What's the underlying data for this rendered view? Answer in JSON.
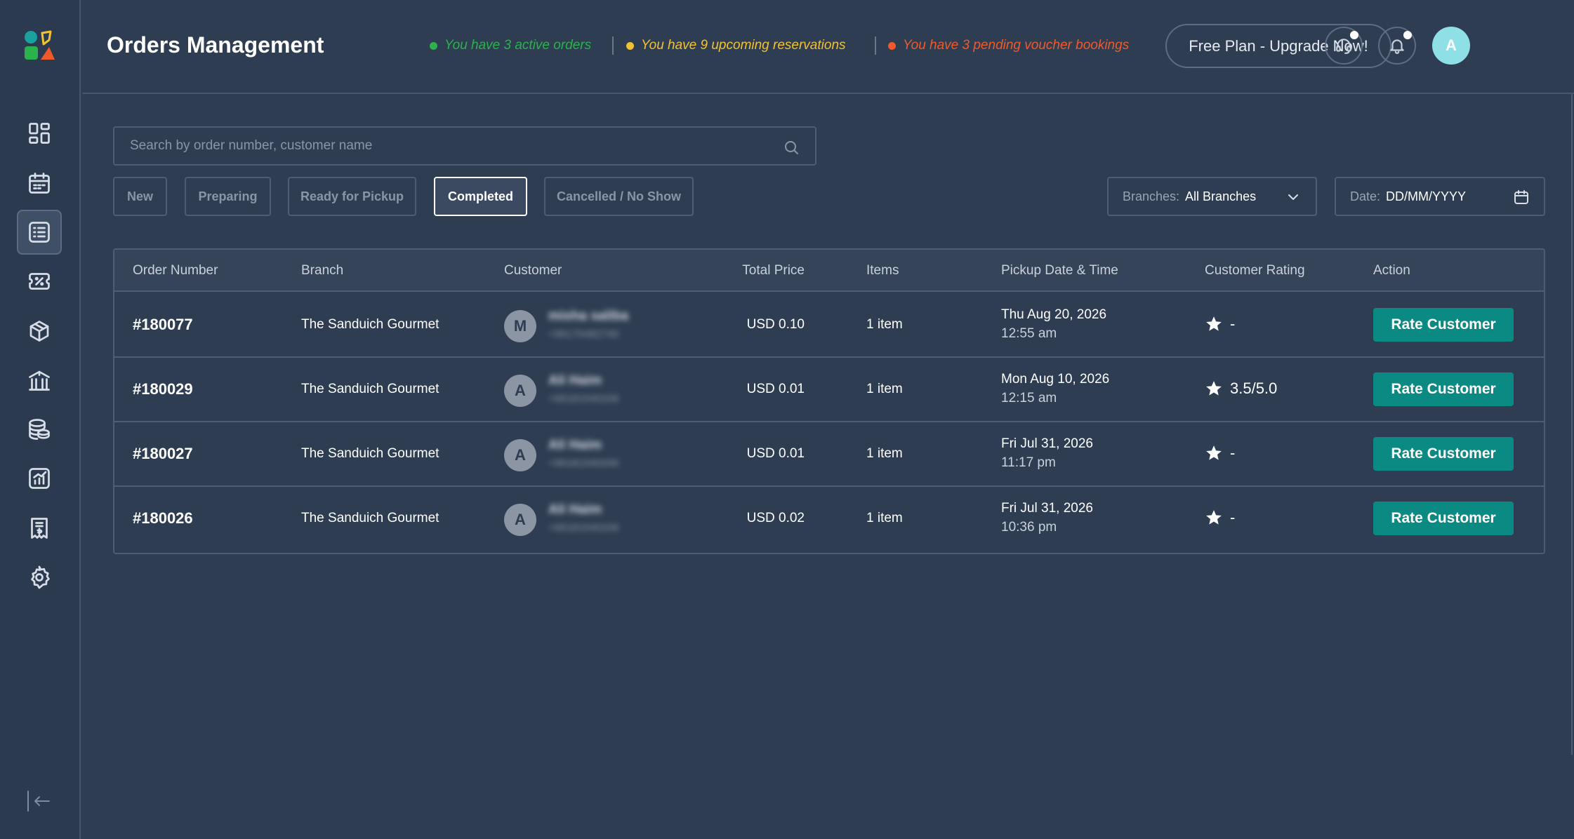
{
  "header": {
    "title": "Orders Management",
    "statuses": [
      {
        "text": "You have 3 active orders",
        "color": "#2bb24c"
      },
      {
        "text": "You have 9 upcoming reservations",
        "color": "#f2c230"
      },
      {
        "text": "You have 3 pending voucher bookings",
        "color": "#f05a2a"
      }
    ],
    "upgrade_label": "Free Plan - Upgrade Now!",
    "avatar_initial": "A"
  },
  "sidebar": {
    "items": [
      {
        "name": "dashboard-icon"
      },
      {
        "name": "calendar-icon"
      },
      {
        "name": "orders-list-icon",
        "active": true
      },
      {
        "name": "voucher-icon"
      },
      {
        "name": "box-icon"
      },
      {
        "name": "branch-icon"
      },
      {
        "name": "coins-icon"
      },
      {
        "name": "analytics-icon"
      },
      {
        "name": "receipt-icon"
      },
      {
        "name": "gear-icon"
      }
    ],
    "logout": "logout-icon"
  },
  "search": {
    "placeholder": "Search by order number, customer name"
  },
  "filters": {
    "tabs": [
      {
        "label": "New"
      },
      {
        "label": "Preparing"
      },
      {
        "label": "Ready for Pickup"
      },
      {
        "label": "Completed",
        "active": true
      },
      {
        "label": "Cancelled / No Show"
      }
    ],
    "branches_label": "Branches:",
    "branches_value": "All Branches",
    "date_label": "Date:",
    "date_value": "DD/MM/YYYY"
  },
  "table": {
    "columns": [
      "Order Number",
      "Branch",
      "Customer",
      "Total Price",
      "Items",
      "Pickup Date & Time",
      "Customer Rating",
      "Action"
    ],
    "rows": [
      {
        "order": "#180077",
        "branch": "The Sanduich Gourmet",
        "initial": "M",
        "customer": "misha saliba",
        "phone": "+96170482740",
        "price": "USD 0.10",
        "items": "1 item",
        "date": "Thu Aug 20, 2026",
        "time": "12:55 am",
        "rating": "-",
        "action": "Rate Customer"
      },
      {
        "order": "#180029",
        "branch": "The Sanduich Gourmet",
        "initial": "A",
        "customer": "Ali Haim",
        "phone": "+96181540206",
        "price": "USD 0.01",
        "items": "1 item",
        "date": "Mon Aug 10, 2026",
        "time": "12:15 am",
        "rating": "3.5/5.0",
        "action": "Rate Customer"
      },
      {
        "order": "#180027",
        "branch": "The Sanduich Gourmet",
        "initial": "A",
        "customer": "Ali Haim",
        "phone": "+96181540206",
        "price": "USD 0.01",
        "items": "1 item",
        "date": "Fri Jul 31, 2026",
        "time": "11:17 pm",
        "rating": "-",
        "action": "Rate Customer"
      },
      {
        "order": "#180026",
        "branch": "The Sanduich Gourmet",
        "initial": "A",
        "customer": "Ali Haim",
        "phone": "+96181540206",
        "price": "USD 0.02",
        "items": "1 item",
        "date": "Fri Jul 31, 2026",
        "time": "10:36 pm",
        "rating": "-",
        "action": "Rate Customer"
      }
    ]
  }
}
